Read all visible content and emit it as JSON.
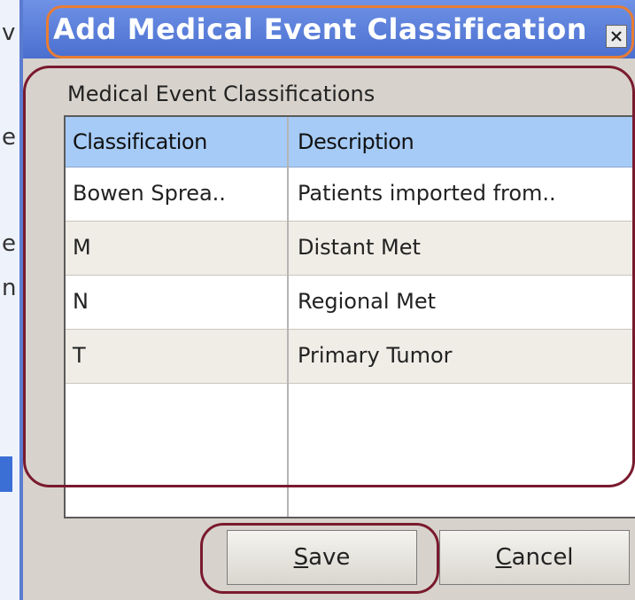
{
  "dialog": {
    "title": "Add Medical Event Classification",
    "close_glyph": "×",
    "section_label": "Medical Event Classifications",
    "table": {
      "columns": [
        "Classification",
        "Description"
      ],
      "rows": [
        {
          "classification": "Bowen Sprea..",
          "description": "Patients imported from.."
        },
        {
          "classification": "M",
          "description": "Distant Met"
        },
        {
          "classification": "N",
          "description": "Regional Met"
        },
        {
          "classification": "T",
          "description": "Primary Tumor"
        }
      ]
    },
    "buttons": {
      "save": {
        "mnemonic": "S",
        "rest": "ave"
      },
      "cancel": {
        "mnemonic": "C",
        "rest": "ancel"
      }
    }
  },
  "background_window": {
    "fragments": [
      "v",
      "e",
      "e",
      "n"
    ]
  },
  "colors": {
    "titlebar": "#5a7ddb",
    "header_row": "#a6cbf7",
    "highlight_orange": "#e87d34",
    "highlight_maroon": "#7a1a2e"
  },
  "icons": {
    "close": "close-icon"
  }
}
